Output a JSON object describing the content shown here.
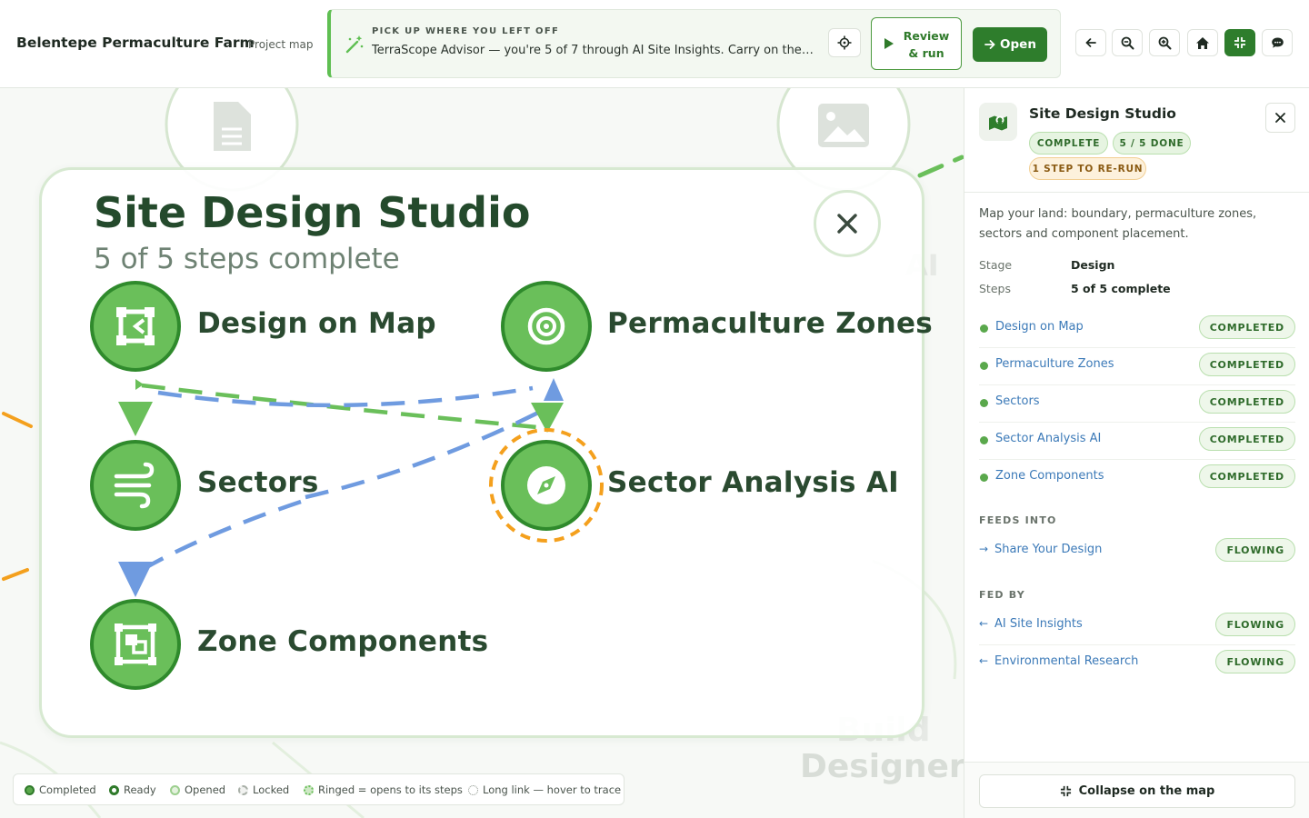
{
  "header": {
    "farm_name": "Belentepe Permaculture Farm",
    "view_label": "Project map",
    "resume": {
      "kicker": "PICK UP WHERE YOU LEFT OFF",
      "message": "TerraScope Advisor — you're 5 of 7 through AI Site Insights. Carry on there…",
      "review_label": "Review & run",
      "open_label": "Open"
    },
    "tools": [
      {
        "icon": "arrow-left-icon"
      },
      {
        "icon": "zoom-out-icon"
      },
      {
        "icon": "zoom-in-icon"
      },
      {
        "icon": "home-icon"
      },
      {
        "icon": "collapse-icon",
        "active": true
      },
      {
        "icon": "chat-icon"
      }
    ]
  },
  "canvas": {
    "background_labels": {
      "designer": "Designer",
      "build": "Build",
      "ai": "AI"
    },
    "card": {
      "title": "Site Design Studio",
      "subtitle": "5 of 5 steps complete",
      "steps": [
        {
          "label": "Design on Map",
          "icon": "crop-frame-icon"
        },
        {
          "label": "Permaculture Zones",
          "icon": "target-icon"
        },
        {
          "label": "Sectors",
          "icon": "wind-icon"
        },
        {
          "label": "Sector Analysis AI",
          "icon": "compass-icon",
          "ringed": true
        },
        {
          "label": "Zone Components",
          "icon": "components-icon"
        }
      ]
    },
    "legend": [
      {
        "label": "Completed"
      },
      {
        "label": "Ready"
      },
      {
        "label": "Opened"
      },
      {
        "label": "Locked"
      },
      {
        "label": "Ringed = opens to its steps"
      },
      {
        "label": "Long link — hover to trace"
      }
    ]
  },
  "panel": {
    "title": "Site Design Studio",
    "badges": {
      "status": "COMPLETE",
      "progress": "5 / 5 DONE",
      "rerun": "1 STEP TO RE-RUN"
    },
    "description": "Map your land: boundary, permaculture zones, sectors and component placement.",
    "stage_key": "Stage",
    "stage_value": "Design",
    "steps_key": "Steps",
    "steps_value": "5 of 5 complete",
    "steps": [
      {
        "name": "Design on Map",
        "status": "COMPLETED"
      },
      {
        "name": "Permaculture Zones",
        "status": "COMPLETED"
      },
      {
        "name": "Sectors",
        "status": "COMPLETED"
      },
      {
        "name": "Sector Analysis AI",
        "status": "COMPLETED"
      },
      {
        "name": "Zone Components",
        "status": "COMPLETED"
      }
    ],
    "feeds_into_heading": "FEEDS INTO",
    "feeds_into": [
      {
        "name": "Share Your Design",
        "status": "FLOWING"
      }
    ],
    "fed_by_heading": "FED BY",
    "fed_by": [
      {
        "name": "AI Site Insights",
        "status": "FLOWING"
      },
      {
        "name": "Environmental Research",
        "status": "FLOWING"
      }
    ],
    "collapse_label": "Collapse on the map"
  },
  "colors": {
    "primary": "#2e7d2c",
    "node": "#6abf5a",
    "node_ring": "#2f8a2c",
    "link_green": "#6abf5a",
    "link_blue": "#6f9be0",
    "ring_orange": "#f4a01d"
  }
}
